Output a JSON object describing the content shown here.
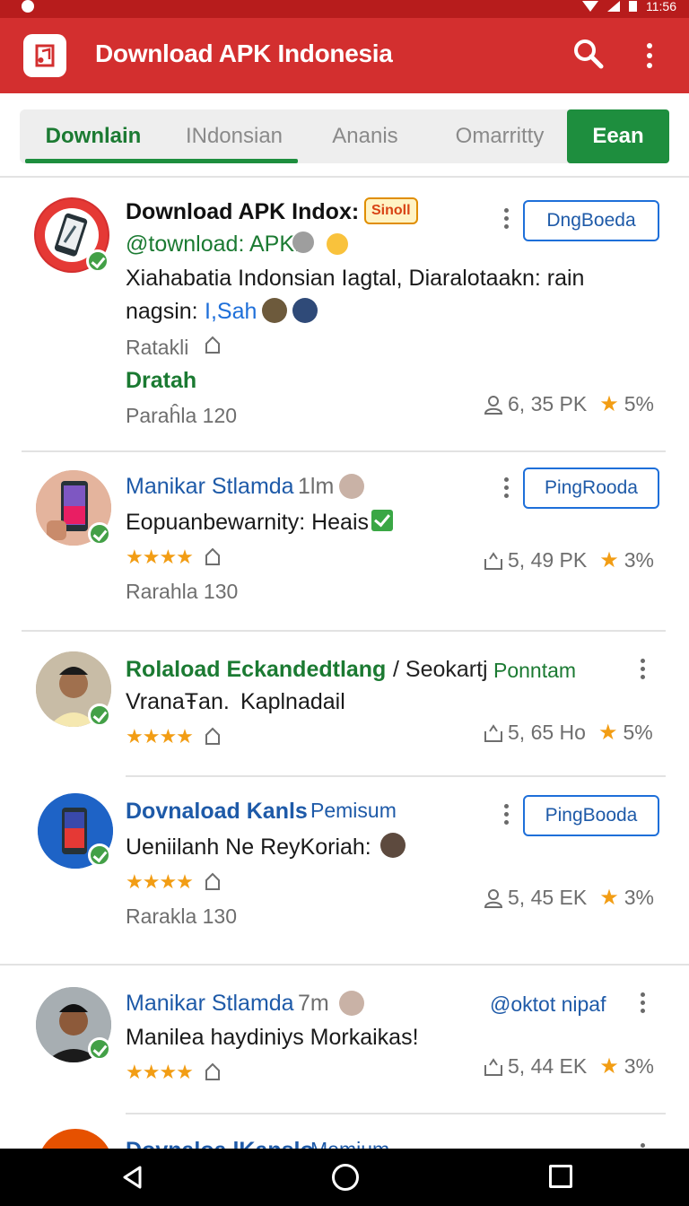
{
  "status_bar": {
    "time": "11:56"
  },
  "app_bar": {
    "title": "Download APK Indonesia"
  },
  "tabs": [
    {
      "label": "Downlain",
      "active": true
    },
    {
      "label": "INdonsian"
    },
    {
      "label": "Ananis"
    },
    {
      "label": "Omarritty"
    },
    {
      "label": "Eean",
      "highlighted": true
    }
  ],
  "posts": [
    {
      "title": "Download APK Indox:",
      "badge": "Sinoll",
      "handle": "@townload: APK:",
      "follow_label": "DngBoeda",
      "body_line1": "Xiahabatia Indonsian Iagtal, Diaralotaakn: rain",
      "body_line2_prefix": "nagsin:",
      "body_line2_link": "I,Sah",
      "meta1": "Ratakli",
      "action_label": "Dratah",
      "meta2": "Paraĥla 120",
      "stat_count": "6, 35 PK",
      "stat_percent": "5%"
    },
    {
      "title": "Manikar Stlamda",
      "time": "1lm",
      "follow_label": "PingRooda",
      "body": "Eopuanbewarnity: Heais",
      "meta": "Rarahla 130",
      "stat_count": "5, 49 PK",
      "stat_percent": "3%"
    },
    {
      "title": "Rolaload Eckandedtlang",
      "title_suffix": "/ Seokartj",
      "title_tag": "Ponntam",
      "subtitle_prefix": "VranaŦan.",
      "subtitle_link": "Kaplnadail",
      "stat_count": "5, 65 Ho",
      "stat_percent": "5%"
    },
    {
      "title": "Dovnaload Kanls",
      "title_tag": "Pemisum",
      "follow_label": "PingBooda",
      "body": "Ueniilanh Ne ReyKoriah:",
      "meta": "Rarakla 130",
      "stat_count": "5, 45 EK",
      "stat_percent": "3%"
    },
    {
      "title": "Manikar Stlamda",
      "time": "7m",
      "handle": "@oktot nipaf",
      "body": "Manilea haydiniys Morkaikas!",
      "stat_count": "5, 44 EK",
      "stat_percent": "3%"
    },
    {
      "title": "Dovnaloa lKanslo",
      "title_tag": "Memium"
    }
  ],
  "stars": "★★★★",
  "star_glyph": "★",
  "colors": {
    "app_bar": "#d32f2f",
    "accent_green": "#1e8e3e",
    "link_blue": "#1e5aa8",
    "star": "#f29d14"
  }
}
